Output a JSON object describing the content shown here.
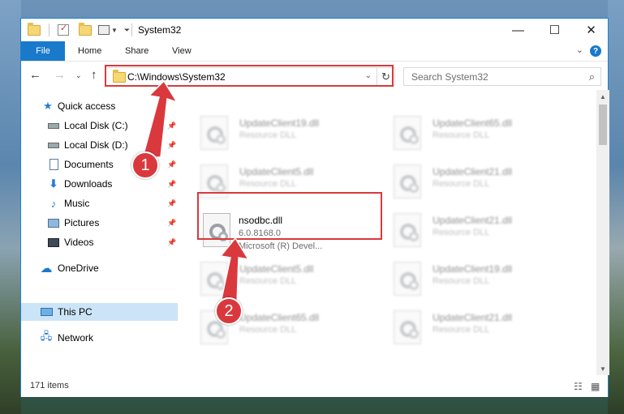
{
  "window": {
    "title": "System32"
  },
  "ribbon": {
    "tabs": [
      "File",
      "Home",
      "Share",
      "View"
    ],
    "help_icon": "?"
  },
  "address": {
    "path": "C:\\Windows\\System32"
  },
  "search": {
    "placeholder": "Search System32"
  },
  "sidebar": {
    "items": [
      {
        "label": "Quick access",
        "icon": "star-icon",
        "pinned": false
      },
      {
        "label": "Local Disk (C:)",
        "icon": "drive-icon",
        "pinned": true
      },
      {
        "label": "Local Disk (D:)",
        "icon": "drive-icon",
        "pinned": true
      },
      {
        "label": "Documents",
        "icon": "documents-icon",
        "pinned": true
      },
      {
        "label": "Downloads",
        "icon": "download-icon",
        "pinned": true
      },
      {
        "label": "Music",
        "icon": "music-icon",
        "pinned": true
      },
      {
        "label": "Pictures",
        "icon": "pictures-icon",
        "pinned": true
      },
      {
        "label": "Videos",
        "icon": "videos-icon",
        "pinned": true
      },
      {
        "label": "OneDrive",
        "icon": "cloud-icon",
        "pinned": false
      },
      {
        "label": "This PC",
        "icon": "computer-icon",
        "pinned": false,
        "selected": true
      },
      {
        "label": "Network",
        "icon": "network-icon",
        "pinned": false
      }
    ]
  },
  "files": {
    "highlighted": {
      "name": "nsodbc.dll",
      "version": "6.0.8168.0",
      "description": "Microsoft (R) Devel..."
    },
    "background": [
      {
        "name": "UpdateClient19.dll",
        "desc": "Resource DLL"
      },
      {
        "name": "UpdateClient65.dll",
        "desc": "Resource DLL"
      },
      {
        "name": "UpdateClient5.dll",
        "desc": "Resource DLL"
      },
      {
        "name": "UpdateClient21.dll",
        "desc": "Resource DLL"
      },
      {
        "name": "UpdateClient21.dll",
        "desc": "Resource DLL"
      },
      {
        "name": "UpdateClient5.dll",
        "desc": "Resource DLL"
      },
      {
        "name": "UpdateClient19.dll",
        "desc": "Resource DLL"
      },
      {
        "name": "UpdateClient65.dll",
        "desc": "Resource DLL"
      },
      {
        "name": "UpdateClient21.dll",
        "desc": "Resource DLL"
      }
    ]
  },
  "status": {
    "item_count": "171 items"
  },
  "annotations": {
    "step1": "1",
    "step2": "2",
    "color": "#d9393d"
  }
}
